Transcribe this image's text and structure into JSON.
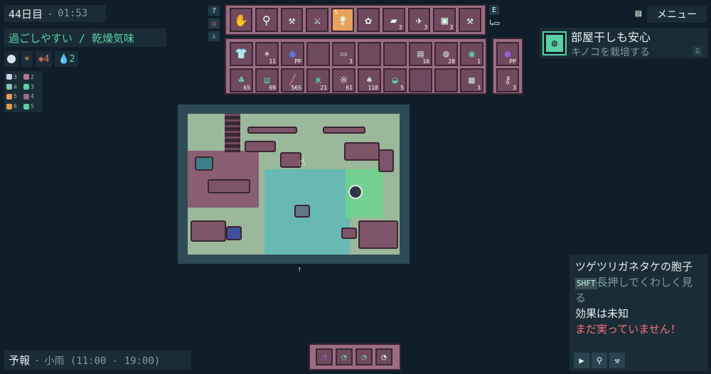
{
  "status": {
    "day": "44日目",
    "separator": "-",
    "time": "01:53",
    "weather": "過ごしやすい / 乾燥気味",
    "stats": [
      {
        "icon": "moon-icon",
        "value": ""
      },
      {
        "icon": "sun-icon",
        "value": ""
      },
      {
        "icon": "spore-icon",
        "value": "4"
      },
      {
        "icon": "water-drop-icon",
        "value": "2"
      }
    ],
    "resources": [
      {
        "icon": "snail-icon",
        "value": "3",
        "color": "#c8d4e8"
      },
      {
        "icon": "plank-icon",
        "value": "2",
        "color": "#b9768f"
      },
      {
        "icon": "ball-icon",
        "value": "4",
        "color": "#8fbfb0"
      },
      {
        "icon": "grass-icon",
        "value": "3",
        "color": "#5bd0a4"
      },
      {
        "icon": "orange-ball-icon",
        "value": "5",
        "color": "#e39a55"
      },
      {
        "icon": "brick-icon",
        "value": "4",
        "color": "#9c6c84"
      },
      {
        "icon": "orange-ball-icon",
        "value": "6",
        "color": "#e39a55"
      },
      {
        "icon": "bush-icon",
        "value": "5",
        "color": "#5bd0a4"
      }
    ]
  },
  "mini_buttons": [
    {
      "label": "?",
      "icon": "help-icon"
    },
    {
      "label": "◎",
      "icon": "target-icon"
    },
    {
      "label": "⇩",
      "icon": "download-icon"
    }
  ],
  "toolbar": {
    "tools": [
      {
        "icon": "hand-icon",
        "glyph": "✋",
        "count": ""
      },
      {
        "icon": "magnifier-icon",
        "glyph": "⚲",
        "count": ""
      },
      {
        "icon": "axe-icon",
        "glyph": "⚒",
        "count": ""
      },
      {
        "icon": "knife-icon",
        "glyph": "⚔",
        "count": ""
      },
      {
        "icon": "shovel-icon",
        "glyph": "⚵",
        "count": "",
        "top": "5",
        "selected": true
      },
      {
        "icon": "moss-icon",
        "glyph": "✿",
        "count": ""
      },
      {
        "icon": "log-icon",
        "glyph": "▰",
        "count": "3"
      },
      {
        "icon": "sprayer-icon",
        "glyph": "✈",
        "count": "3"
      },
      {
        "icon": "tank-icon",
        "glyph": "▣",
        "count": "3"
      },
      {
        "icon": "hatchet-icon",
        "glyph": "⚒",
        "count": ""
      }
    ],
    "e_key": "E"
  },
  "inventory": {
    "slots": [
      {
        "icon": "shirt-icon",
        "glyph": "👕",
        "count": ""
      },
      {
        "icon": "beetle-icon",
        "glyph": "✶",
        "count": "11"
      },
      {
        "icon": "frog-icon",
        "glyph": "●",
        "count": "PP"
      },
      {
        "icon": "empty-slot",
        "glyph": "",
        "count": ""
      },
      {
        "icon": "monitor-icon",
        "glyph": "▭",
        "count": "3"
      },
      {
        "icon": "empty-slot",
        "glyph": "",
        "count": ""
      },
      {
        "icon": "empty-slot",
        "glyph": "",
        "count": ""
      },
      {
        "icon": "box-icon",
        "glyph": "▤",
        "count": "10"
      },
      {
        "icon": "drum-icon",
        "glyph": "◍",
        "count": "28"
      },
      {
        "icon": "barrel-icon",
        "glyph": "◉",
        "count": "1"
      },
      {
        "icon": "sapling-icon",
        "glyph": "♣",
        "count": "65"
      },
      {
        "icon": "grass-icon",
        "glyph": "ш",
        "count": "69"
      },
      {
        "icon": "stick-icon",
        "glyph": "╱",
        "count": "565"
      },
      {
        "icon": "weed-icon",
        "glyph": "ж",
        "count": "21"
      },
      {
        "icon": "spider-icon",
        "glyph": "※",
        "count": "61"
      },
      {
        "icon": "mushroom-icon",
        "glyph": "♠",
        "count": "118"
      },
      {
        "icon": "pot-icon",
        "glyph": "◒",
        "count": "5"
      },
      {
        "icon": "empty-slot",
        "glyph": "",
        "count": ""
      },
      {
        "icon": "empty-slot",
        "glyph": "",
        "count": ""
      },
      {
        "icon": "cabinet-icon",
        "glyph": "▦",
        "count": "3"
      }
    ],
    "side": [
      {
        "icon": "purple-frog-icon",
        "glyph": "●",
        "count": "PP"
      },
      {
        "icon": "wrench-icon",
        "glyph": "⚷",
        "count": "3"
      }
    ]
  },
  "quest": {
    "title": "部屋干しも安心",
    "subtitle": "キノコを栽培する",
    "key": "G"
  },
  "menu": {
    "label": "メニュー"
  },
  "description": {
    "title": "ツゲツリガネタケの胞子",
    "shift_key": "SHFT",
    "hint": "長押しでくわしく見る",
    "effect": "効果は未知",
    "warning": "まだ実っていません！"
  },
  "forecast": {
    "label": "予報",
    "separator": "-",
    "value": "小雨 (11:00 - 19:00)"
  },
  "hotbar": [
    {
      "icon": "purple-seed-icon",
      "color": "#8b5fbf"
    },
    {
      "icon": "green-seed-icon",
      "color": "#5bd0a4"
    },
    {
      "icon": "teal-seed-icon",
      "color": "#7fb7a5"
    },
    {
      "icon": "white-seed-icon",
      "color": "#cfe"
    }
  ]
}
